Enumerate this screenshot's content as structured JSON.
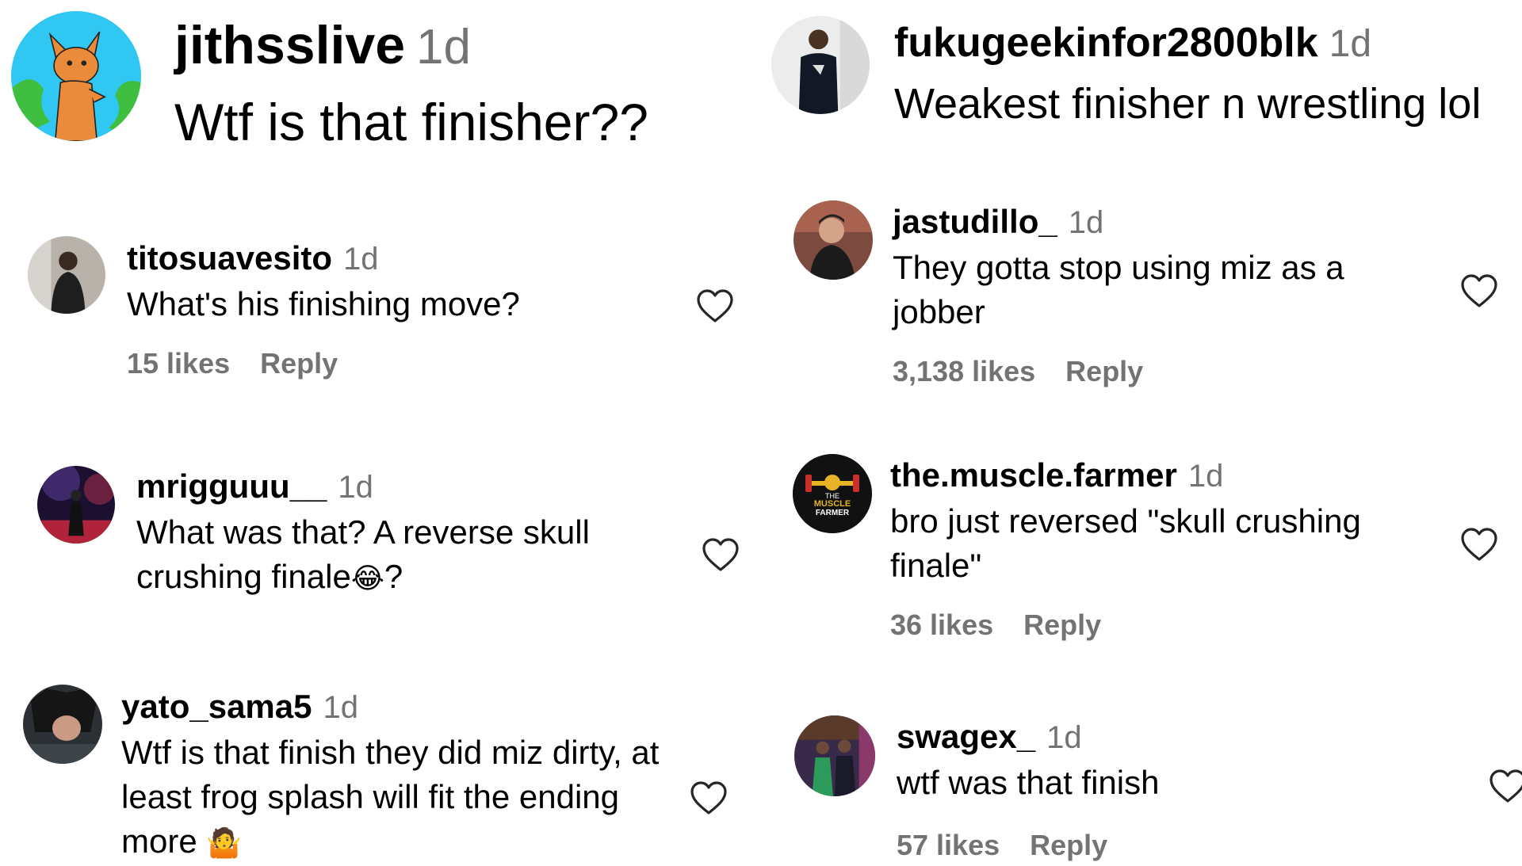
{
  "featured": [
    {
      "user": "jithsslive",
      "time": "1d",
      "text": "Wtf is that finisher??"
    },
    {
      "user": "fukugeekinfor2800blk",
      "time": "1d",
      "text": "Weakest finisher n wrestling lol"
    }
  ],
  "left_comments": [
    {
      "user": "titosuavesito",
      "time": "1d",
      "text": "What's his finishing move?",
      "likes": "15 likes",
      "reply": "Reply"
    },
    {
      "user": "mrigguuu__",
      "time": "1d",
      "text": "What was that? A reverse skull crushing finale",
      "emoji": "😂",
      "text_end": "?"
    },
    {
      "user": "yato_sama5",
      "time": "1d",
      "text": "Wtf is that finish they did miz dirty, at least frog splash will fit the ending more",
      "emoji": "🤷"
    }
  ],
  "right_comments": [
    {
      "user": "jastudillo_",
      "time": "1d",
      "text": "They gotta stop using miz as a jobber",
      "likes": "3,138 likes",
      "reply": "Reply"
    },
    {
      "user": "the.muscle.farmer",
      "time": "1d",
      "text": "bro just reversed \"skull crushing finale\"",
      "likes": "36 likes",
      "reply": "Reply"
    },
    {
      "user": "swagex_",
      "time": "1d",
      "text": "wtf was that finish",
      "likes": "57 likes",
      "reply": "Reply"
    }
  ],
  "avatar_logo_text": [
    "THE",
    "MUSCLE",
    "FARMER"
  ],
  "colors": {
    "text": "#000000",
    "muted": "#737373",
    "background": "#ffffff",
    "heart_stroke": "#262626"
  }
}
